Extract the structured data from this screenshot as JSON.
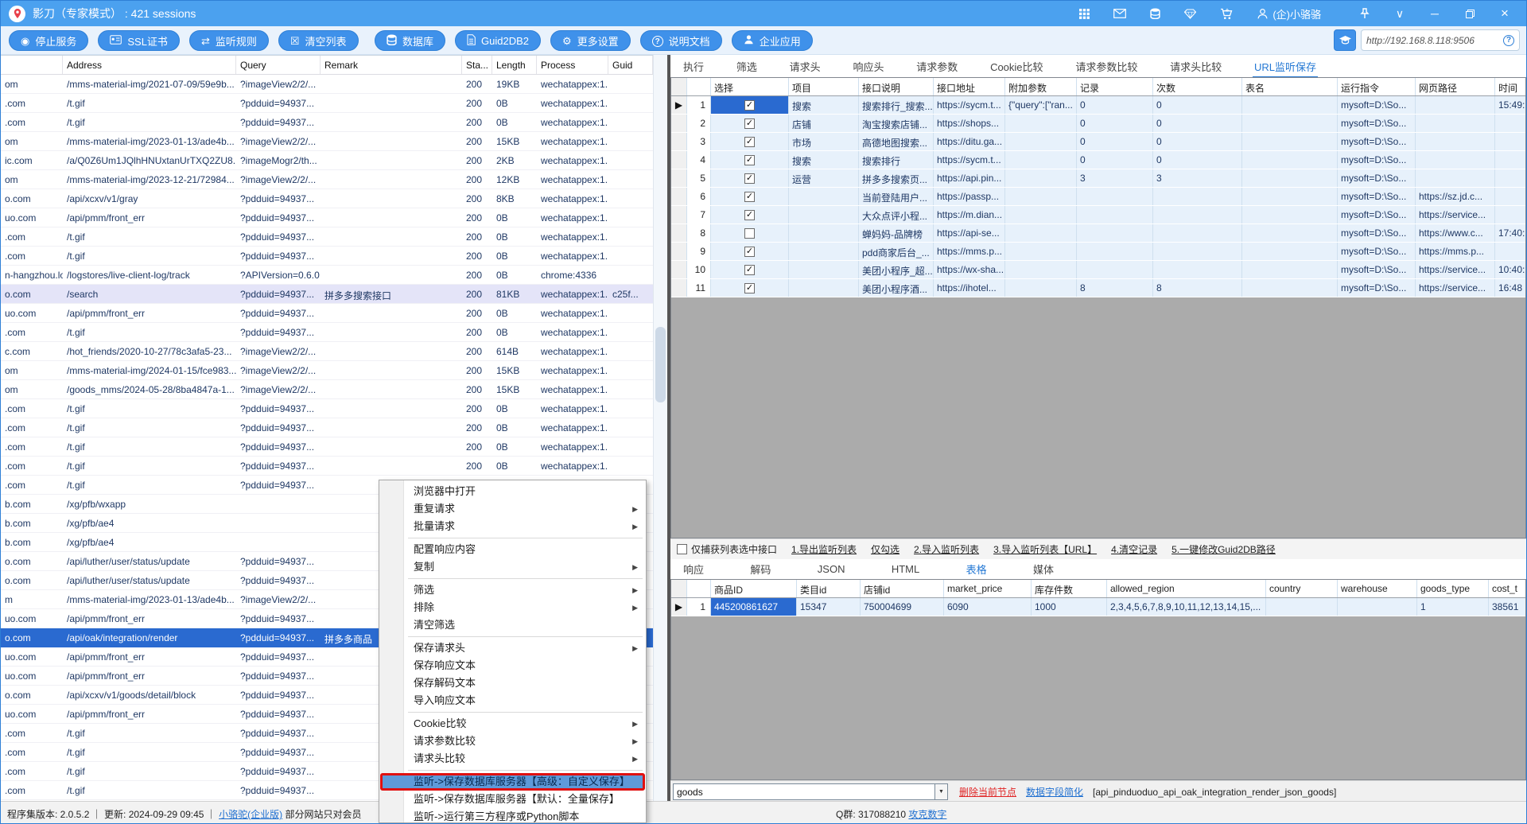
{
  "titlebar": {
    "title": "影刀（专家模式） : 421 sessions",
    "status_icons": [
      "apps-grid-icon",
      "mail-icon",
      "database-icon",
      "diamond-icon",
      "cart-icon"
    ],
    "user": "(企)小骆骆"
  },
  "toolbar": {
    "buttons_left": [
      {
        "label": "停止服务",
        "icon": "stop-icon"
      },
      {
        "label": "SSL证书",
        "icon": "certificate-icon"
      },
      {
        "label": "监听规则",
        "icon": "listen-rules-icon"
      },
      {
        "label": "清空列表",
        "icon": "clear-list-icon"
      }
    ],
    "buttons_mid": [
      {
        "label": "数据库",
        "icon": "database-icon"
      },
      {
        "label": "Guid2DB2",
        "icon": "document-icon"
      },
      {
        "label": "更多设置",
        "icon": "settings-icon"
      },
      {
        "label": "说明文档",
        "icon": "help-icon"
      },
      {
        "label": "企业应用",
        "icon": "enterprise-icon"
      }
    ],
    "url": "http://192.168.8.118:9506"
  },
  "left_table": {
    "columns": [
      "",
      "Address",
      "Query",
      "Remark",
      "Sta...",
      "Length",
      "Process",
      "Guid"
    ],
    "rows": [
      [
        "om",
        "/mms-material-img/2021-07-09/59e9b...",
        "?imageView2/2/...",
        "",
        "200",
        "19KB",
        "wechatappex:1...",
        "",
        ""
      ],
      [
        ".com",
        "/t.gif",
        "?pdduid=94937...",
        "",
        "200",
        "0B",
        "wechatappex:1...",
        "",
        ""
      ],
      [
        ".com",
        "/t.gif",
        "?pdduid=94937...",
        "",
        "200",
        "0B",
        "wechatappex:1...",
        "",
        ""
      ],
      [
        "om",
        "/mms-material-img/2023-01-13/ade4b...",
        "?imageView2/2/...",
        "",
        "200",
        "15KB",
        "wechatappex:1...",
        "",
        ""
      ],
      [
        "ic.com",
        "/a/Q0Z6Um1JQlhHNUxtanUrTXQ2ZU8...",
        "?imageMogr2/th...",
        "",
        "200",
        "2KB",
        "wechatappex:1...",
        "",
        ""
      ],
      [
        "om",
        "/mms-material-img/2023-12-21/72984...",
        "?imageView2/2/...",
        "",
        "200",
        "12KB",
        "wechatappex:1...",
        "",
        ""
      ],
      [
        "o.com",
        "/api/xcxv/v1/gray",
        "?pdduid=94937...",
        "",
        "200",
        "8KB",
        "wechatappex:1...",
        "",
        ""
      ],
      [
        "uo.com",
        "/api/pmm/front_err",
        "?pdduid=94937...",
        "",
        "200",
        "0B",
        "wechatappex:1...",
        "",
        ""
      ],
      [
        ".com",
        "/t.gif",
        "?pdduid=94937...",
        "",
        "200",
        "0B",
        "wechatappex:1...",
        "",
        ""
      ],
      [
        ".com",
        "/t.gif",
        "?pdduid=94937...",
        "",
        "200",
        "0B",
        "wechatappex:1...",
        "",
        ""
      ],
      [
        "n-hangzhou.log...",
        "/logstores/live-client-log/track",
        "?APIVersion=0.6.0",
        "",
        "200",
        "0B",
        "chrome:4336",
        "",
        ""
      ],
      [
        "o.com",
        "/search",
        "?pdduid=94937...",
        "拼多多搜索接口",
        "200",
        "81KB",
        "wechatappex:1...",
        "c25f...",
        "hl"
      ],
      [
        "uo.com",
        "/api/pmm/front_err",
        "?pdduid=94937...",
        "",
        "200",
        "0B",
        "wechatappex:1...",
        "",
        ""
      ],
      [
        ".com",
        "/t.gif",
        "?pdduid=94937...",
        "",
        "200",
        "0B",
        "wechatappex:1...",
        "",
        ""
      ],
      [
        "c.com",
        "/hot_friends/2020-10-27/78c3afa5-23...",
        "?imageView2/2/...",
        "",
        "200",
        "614B",
        "wechatappex:1...",
        "",
        ""
      ],
      [
        "om",
        "/mms-material-img/2024-01-15/fce983...",
        "?imageView2/2/...",
        "",
        "200",
        "15KB",
        "wechatappex:1...",
        "",
        ""
      ],
      [
        "om",
        "/goods_mms/2024-05-28/8ba4847a-1...",
        "?imageView2/2/...",
        "",
        "200",
        "15KB",
        "wechatappex:1...",
        "",
        ""
      ],
      [
        ".com",
        "/t.gif",
        "?pdduid=94937...",
        "",
        "200",
        "0B",
        "wechatappex:1...",
        "",
        ""
      ],
      [
        ".com",
        "/t.gif",
        "?pdduid=94937...",
        "",
        "200",
        "0B",
        "wechatappex:1...",
        "",
        ""
      ],
      [
        ".com",
        "/t.gif",
        "?pdduid=94937...",
        "",
        "200",
        "0B",
        "wechatappex:1...",
        "",
        ""
      ],
      [
        ".com",
        "/t.gif",
        "?pdduid=94937...",
        "",
        "200",
        "0B",
        "wechatappex:1...",
        "",
        ""
      ],
      [
        ".com",
        "/t.gif",
        "?pdduid=94937...",
        "",
        "200",
        "0B",
        "wechatappex:1...",
        "",
        ""
      ],
      [
        "b.com",
        "/xg/pfb/wxapp",
        "",
        "",
        "",
        "",
        "",
        "",
        ""
      ],
      [
        "b.com",
        "/xg/pfb/ae4",
        "",
        "",
        "",
        "",
        "",
        "",
        ""
      ],
      [
        "b.com",
        "/xg/pfb/ae4",
        "",
        "",
        "",
        "",
        "",
        "",
        ""
      ],
      [
        "o.com",
        "/api/luther/user/status/update",
        "?pdduid=94937...",
        "",
        "",
        "",
        "",
        "",
        ""
      ],
      [
        "o.com",
        "/api/luther/user/status/update",
        "?pdduid=94937...",
        "",
        "",
        "",
        "",
        "",
        ""
      ],
      [
        "m",
        "/mms-material-img/2023-01-13/ade4b...",
        "?imageView2/2/...",
        "",
        "",
        "",
        "",
        "",
        ""
      ],
      [
        "uo.com",
        "/api/pmm/front_err",
        "?pdduid=94937...",
        "",
        "",
        "",
        "",
        "",
        ""
      ],
      [
        "o.com",
        "/api/oak/integration/render",
        "?pdduid=94937...",
        "拼多多商品",
        "",
        "",
        "",
        "",
        "sel"
      ],
      [
        "uo.com",
        "/api/pmm/front_err",
        "?pdduid=94937...",
        "",
        "",
        "",
        "",
        "",
        ""
      ],
      [
        "uo.com",
        "/api/pmm/front_err",
        "?pdduid=94937...",
        "",
        "",
        "",
        "",
        "",
        ""
      ],
      [
        "o.com",
        "/api/xcxv/v1/goods/detail/block",
        "?pdduid=94937...",
        "",
        "",
        "",
        "",
        "",
        ""
      ],
      [
        "uo.com",
        "/api/pmm/front_err",
        "?pdduid=94937...",
        "",
        "",
        "",
        "",
        "",
        ""
      ],
      [
        ".com",
        "/t.gif",
        "?pdduid=94937...",
        "",
        "",
        "",
        "",
        "",
        ""
      ],
      [
        ".com",
        "/t.gif",
        "?pdduid=94937...",
        "",
        "",
        "",
        "",
        "",
        ""
      ],
      [
        ".com",
        "/t.gif",
        "?pdduid=94937...",
        "",
        "",
        "",
        "",
        "",
        ""
      ],
      [
        ".com",
        "/t.gif",
        "?pdduid=94937...",
        "",
        "",
        "",
        "",
        "",
        ""
      ]
    ]
  },
  "right_tabs": {
    "items": [
      "执行",
      "筛选",
      "请求头",
      "响应头",
      "请求参数",
      "Cookie比较",
      "请求参数比较",
      "请求头比较",
      "URL监听保存"
    ],
    "selected": "URL监听保存"
  },
  "listen_table": {
    "columns": [
      "选择",
      "项目",
      "接口说明",
      "接口地址",
      "附加参数",
      "记录",
      "次数",
      "表名",
      "运行指令",
      "网页路径",
      "时间"
    ],
    "rows": [
      {
        "n": "1",
        "cur": true,
        "checked": true,
        "check_selected": true,
        "cells": [
          "搜索",
          "搜索排行_搜索...",
          "https://sycm.t...",
          "{\"query\":[\"ran...",
          "0",
          "0",
          "",
          "mysoft=D:\\So...",
          "",
          "15:49:"
        ]
      },
      {
        "n": "2",
        "cur": false,
        "checked": true,
        "check_selected": false,
        "cells": [
          "店铺",
          "淘宝搜索店铺...",
          "https://shops...",
          "",
          "0",
          "0",
          "",
          "mysoft=D:\\So...",
          "",
          ""
        ]
      },
      {
        "n": "3",
        "cur": false,
        "checked": true,
        "check_selected": false,
        "cells": [
          "市场",
          "高德地图搜索...",
          "https://ditu.ga...",
          "",
          "0",
          "0",
          "",
          "mysoft=D:\\So...",
          "",
          ""
        ]
      },
      {
        "n": "4",
        "cur": false,
        "checked": true,
        "check_selected": false,
        "cells": [
          "搜索",
          "搜索排行",
          "https://sycm.t...",
          "",
          "0",
          "0",
          "",
          "mysoft=D:\\So...",
          "",
          ""
        ]
      },
      {
        "n": "5",
        "cur": false,
        "checked": true,
        "check_selected": false,
        "cells": [
          "运营",
          "拼多多搜索页...",
          "https://api.pin...",
          "",
          "3",
          "3",
          "",
          "mysoft=D:\\So...",
          "",
          ""
        ]
      },
      {
        "n": "6",
        "cur": false,
        "checked": true,
        "check_selected": false,
        "cells": [
          "",
          "当前登陆用户...",
          "https://passp...",
          "",
          "",
          "",
          "",
          "mysoft=D:\\So...",
          "https://sz.jd.c...",
          ""
        ]
      },
      {
        "n": "7",
        "cur": false,
        "checked": true,
        "check_selected": false,
        "cells": [
          "",
          "大众点评小程...",
          "https://m.dian...",
          "",
          "",
          "",
          "",
          "mysoft=D:\\So...",
          "https://service...",
          ""
        ]
      },
      {
        "n": "8",
        "cur": false,
        "checked": false,
        "check_selected": false,
        "cells": [
          "",
          "蝉妈妈-品牌榜",
          "https://api-se...",
          "",
          "",
          "",
          "",
          "mysoft=D:\\So...",
          "https://www.c...",
          "17:40:"
        ]
      },
      {
        "n": "9",
        "cur": false,
        "checked": true,
        "check_selected": false,
        "cells": [
          "",
          "pdd商家后台_...",
          "https://mms.p...",
          "",
          "",
          "",
          "",
          "mysoft=D:\\So...",
          "https://mms.p...",
          ""
        ]
      },
      {
        "n": "10",
        "cur": false,
        "checked": true,
        "check_selected": false,
        "cells": [
          "",
          "美团小程序_超...",
          "https://wx-sha...",
          "",
          "",
          "",
          "",
          "mysoft=D:\\So...",
          "https://service...",
          "10:40:"
        ]
      },
      {
        "n": "11",
        "cur": false,
        "checked": true,
        "check_selected": false,
        "cells": [
          "",
          "美团小程序酒...",
          "https://ihotel...",
          "",
          "8",
          "8",
          "",
          "mysoft=D:\\So...",
          "https://service...",
          "16:48"
        ]
      }
    ]
  },
  "listen_links": {
    "checkbox_label": "仅捕获列表选中接口",
    "links": [
      "1.导出监听列表",
      "仅勾选",
      "2.导入监听列表",
      "3.导入监听列表【URL】",
      "4.清空记录",
      "5.一键修改Guid2DB路径"
    ]
  },
  "response_tabs": {
    "items": [
      "响应",
      "解码",
      "JSON",
      "HTML",
      "表格",
      "媒体"
    ],
    "selected": "表格"
  },
  "goods_table": {
    "columns": [
      "商品ID",
      "类目id",
      "店铺id",
      "market_price",
      "库存件数",
      "allowed_region",
      "country",
      "warehouse",
      "goods_type",
      "cost_t"
    ],
    "row_number": "1",
    "row": [
      "445200861627",
      "15347",
      "750004699",
      "6090",
      "1000",
      "2,3,4,5,6,7,8,9,10,11,12,13,14,15,...",
      "",
      "",
      "1",
      "38561"
    ]
  },
  "goods_footer": {
    "input_value": "goods",
    "delete_link": "删除当前节点",
    "simplify_link": "数据字段简化",
    "table_ref": "[api_pinduoduo_api_oak_integration_render_json_goods]"
  },
  "statusbar": {
    "left_text": "程序集版本: 2.0.5.2 ｜ 更新: 2024-09-29 09:45 ｜ ",
    "edition_link": "小骆驼(企业版)",
    "notice": " 部分网站只对会员",
    "qq_text": "Q群: 317088210 ",
    "qq_link": "攻克数字"
  },
  "context_menu": {
    "items": [
      {
        "label": "浏览器中打开",
        "arrow": false,
        "sep": false,
        "highlight": false
      },
      {
        "label": "重复请求",
        "arrow": true,
        "sep": false,
        "highlight": false
      },
      {
        "label": "批量请求",
        "arrow": true,
        "sep": true,
        "highlight": false
      },
      {
        "label": "配置响应内容",
        "arrow": false,
        "sep": false,
        "highlight": false
      },
      {
        "label": "复制",
        "arrow": true,
        "sep": true,
        "highlight": false
      },
      {
        "label": "筛选",
        "arrow": true,
        "sep": false,
        "highlight": false
      },
      {
        "label": "排除",
        "arrow": true,
        "sep": false,
        "highlight": false
      },
      {
        "label": "清空筛选",
        "arrow": false,
        "sep": true,
        "highlight": false
      },
      {
        "label": "保存请求头",
        "arrow": true,
        "sep": false,
        "highlight": false
      },
      {
        "label": "保存响应文本",
        "arrow": false,
        "sep": false,
        "highlight": false
      },
      {
        "label": "保存解码文本",
        "arrow": false,
        "sep": false,
        "highlight": false
      },
      {
        "label": "导入响应文本",
        "arrow": false,
        "sep": true,
        "highlight": false
      },
      {
        "label": "Cookie比较",
        "arrow": true,
        "sep": false,
        "highlight": false
      },
      {
        "label": "请求参数比较",
        "arrow": true,
        "sep": false,
        "highlight": false
      },
      {
        "label": "请求头比较",
        "arrow": true,
        "sep": true,
        "highlight": false
      },
      {
        "label": "监听->保存数据库服务器【高级：自定义保存】",
        "arrow": false,
        "sep": false,
        "highlight": true
      },
      {
        "label": "监听->保存数据库服务器【默认：全量保存】",
        "arrow": false,
        "sep": false,
        "highlight": false
      },
      {
        "label": "监听->运行第三方程序或Python脚本",
        "arrow": false,
        "sep": false,
        "highlight": false
      }
    ]
  },
  "colors": {
    "titlebar": "#4ba1ef",
    "button_blue": "#3f91ea",
    "selected_row": "#2a6ad0",
    "highlight_row": "#e4e4f8",
    "grid_row": "#e7f1fb",
    "menu_highlight": "#5f9ad9",
    "red_box": "#e01010"
  }
}
